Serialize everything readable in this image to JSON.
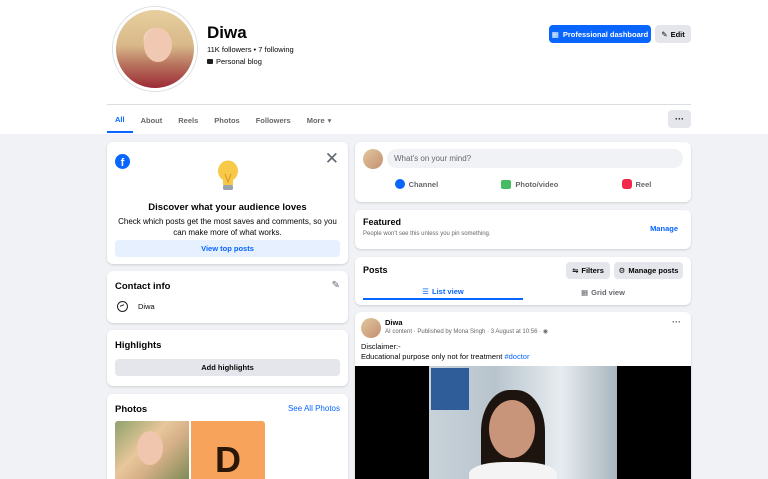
{
  "profile": {
    "name": "Diwa",
    "stats": "11K followers • 7 following",
    "category": "Personal blog",
    "pro_button": "Professional dashboard",
    "edit_button": "Edit"
  },
  "tabs": [
    "All",
    "About",
    "Reels",
    "Photos",
    "Followers",
    "More"
  ],
  "tabs_more_button": "···",
  "discover": {
    "title": "Discover what your audience loves",
    "description": "Check which posts get the most saves and comments, so you can make more of what works.",
    "button": "View top posts",
    "logo": "f"
  },
  "contact": {
    "title": "Contact info",
    "name": "Diwa"
  },
  "highlights": {
    "title": "Highlights",
    "button": "Add highlights"
  },
  "photos": {
    "title": "Photos",
    "see_all": "See All Photos",
    "tile_letter": "D"
  },
  "composer": {
    "placeholder": "What's on your mind?",
    "actions": [
      "Channel",
      "Photo/video",
      "Reel"
    ]
  },
  "featured": {
    "title": "Featured",
    "subtitle": "People won't see this unless you pin something.",
    "manage": "Manage"
  },
  "posts": {
    "title": "Posts",
    "filters": "Filters",
    "manage_posts": "Manage posts",
    "list_view": "List view",
    "grid_view": "Grid view"
  },
  "post": {
    "author": "Diwa",
    "meta": "AI content · Published by Mona Singh · 3 August at 10:56 ·",
    "line1": "Disclaimer:-",
    "line2": "Educational purpose only not for treatment",
    "hashtag": "#doctor"
  },
  "colors": {
    "accent": "#0866ff",
    "background": "#f0f2f5"
  }
}
